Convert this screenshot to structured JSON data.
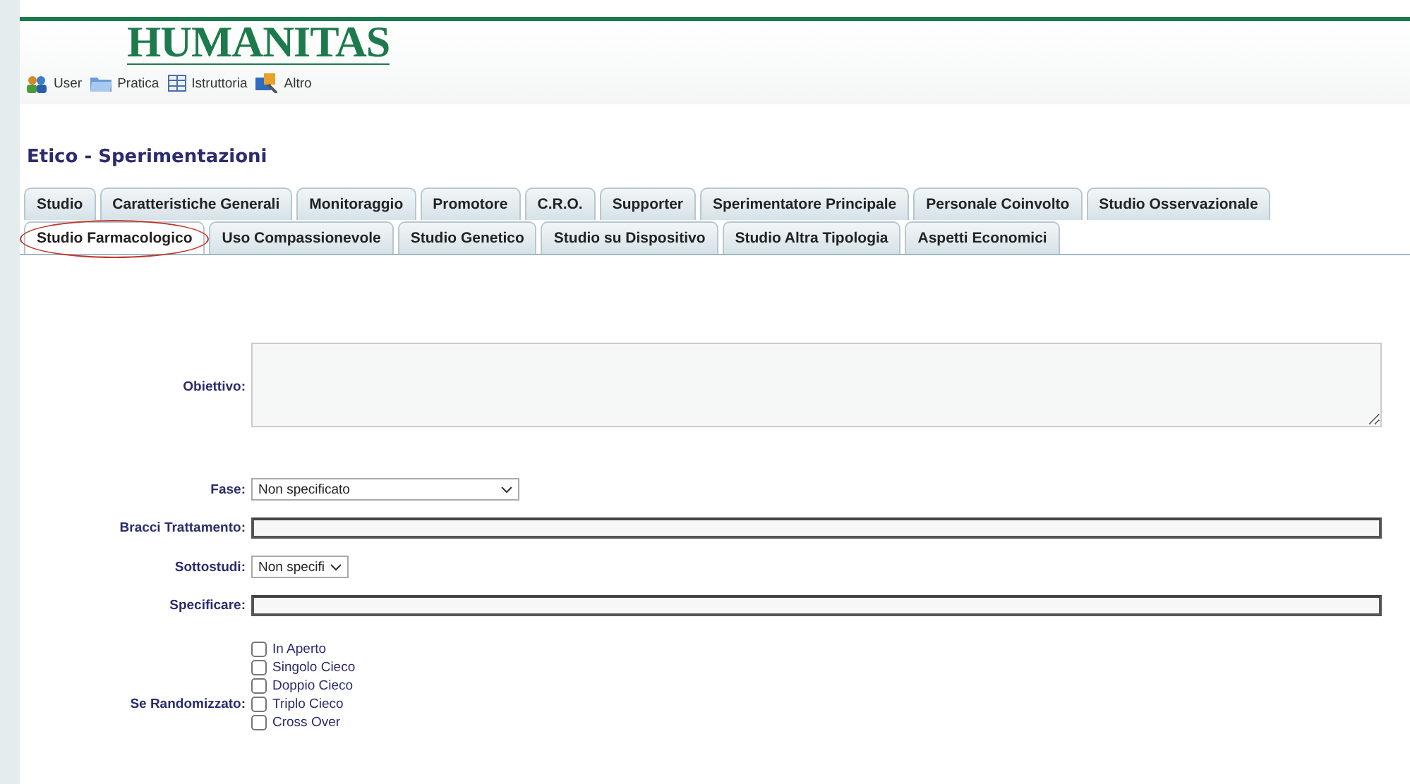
{
  "logo": "HUMANITAS",
  "nav": [
    {
      "label": "User"
    },
    {
      "label": "Pratica"
    },
    {
      "label": "Istruttoria"
    },
    {
      "label": "Altro"
    }
  ],
  "title": "Etico - Sperimentazioni",
  "tab_rows": [
    [
      {
        "label": "Studio",
        "selected": false,
        "circled": false
      },
      {
        "label": "Caratteristiche Generali",
        "selected": false,
        "circled": false
      },
      {
        "label": "Monitoraggio",
        "selected": false,
        "circled": false
      },
      {
        "label": "Promotore",
        "selected": false,
        "circled": false
      },
      {
        "label": "C.R.O.",
        "selected": false,
        "circled": false
      },
      {
        "label": "Supporter",
        "selected": false,
        "circled": false
      },
      {
        "label": "Sperimentatore Principale",
        "selected": false,
        "circled": false
      },
      {
        "label": "Personale Coinvolto",
        "selected": false,
        "circled": false
      },
      {
        "label": "Studio Osservazionale",
        "selected": false,
        "circled": false
      }
    ],
    [
      {
        "label": "Studio Farmacologico",
        "selected": true,
        "circled": true
      },
      {
        "label": "Uso Compassionevole",
        "selected": false,
        "circled": false
      },
      {
        "label": "Studio Genetico",
        "selected": false,
        "circled": false
      },
      {
        "label": "Studio su Dispositivo",
        "selected": false,
        "circled": false
      },
      {
        "label": "Studio Altra Tipologia",
        "selected": false,
        "circled": false
      },
      {
        "label": "Aspetti Economici",
        "selected": false,
        "circled": false
      }
    ]
  ],
  "fields": [
    {
      "kind": "textarea",
      "label": "Obiettivo:"
    },
    {
      "kind": "select",
      "label": "Fase:",
      "value": "Non specificato"
    },
    {
      "kind": "text",
      "label": "Bracci Trattamento:"
    },
    {
      "kind": "select",
      "label": "Sottostudi:",
      "value": "Non specifi"
    },
    {
      "kind": "text",
      "label": "Specificare:"
    }
  ],
  "randomization": {
    "label": "Se Randomizzato:",
    "options": [
      {
        "label": "In Aperto",
        "checked": false
      },
      {
        "label": "Singolo Cieco",
        "checked": false
      },
      {
        "label": "Doppio Cieco",
        "checked": false
      },
      {
        "label": "Triplo Cieco",
        "checked": false
      },
      {
        "label": "Cross Over",
        "checked": false
      }
    ]
  }
}
